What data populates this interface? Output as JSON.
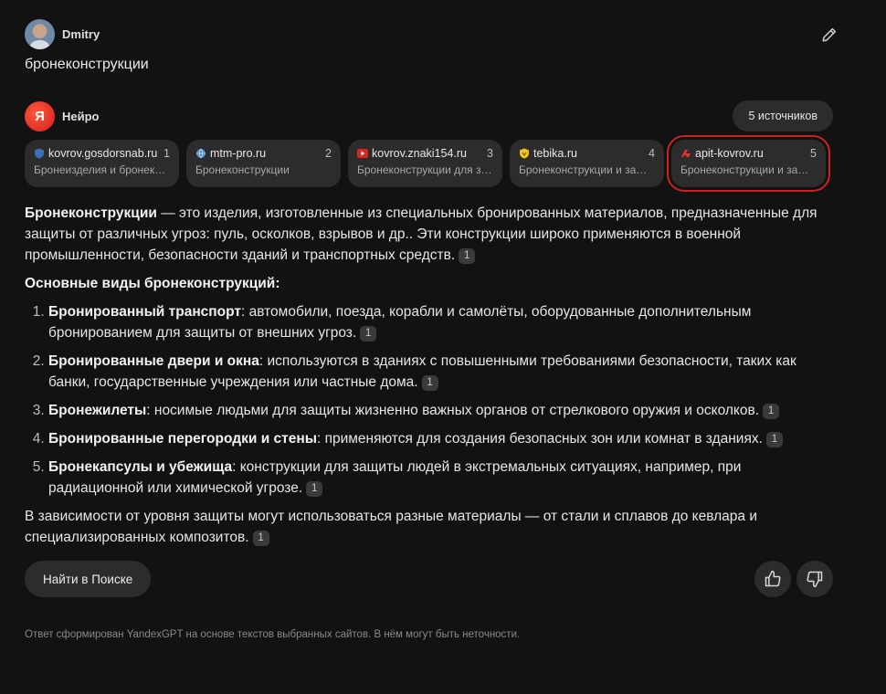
{
  "user": {
    "name": "Dmitry"
  },
  "query": "бронеконструкции",
  "neuro": {
    "logo_text": "Я",
    "name": "Нейро"
  },
  "sources_button": "5 источников",
  "sources": [
    {
      "domain": "kovrov.gosdorsnab.ru",
      "num": "1",
      "desc": "Бронеизделия и бронеконструкции",
      "icon": "shield-blue-icon"
    },
    {
      "domain": "mtm-pro.ru",
      "num": "2",
      "desc": "Бронеконструкции",
      "icon": "globe-icon"
    },
    {
      "domain": "kovrov.znaki154.ru",
      "num": "3",
      "desc": "Бронеконструкции для защиты",
      "icon": "red-play-icon"
    },
    {
      "domain": "tebika.ru",
      "num": "4",
      "desc": "Бронеконструкции и защитные",
      "icon": "yellow-shield-icon"
    },
    {
      "domain": "apit-kovrov.ru",
      "num": "5",
      "desc": "Бронеконструкции и защита",
      "icon": "red-logo-icon"
    }
  ],
  "answer": {
    "intro_bold": "Бронеконструкции",
    "intro_text": " — это изделия, изготовленные из специальных бронированных материалов, предназначенные для защиты от различных угроз: пуль, осколков, взрывов и др.. Эти конструкции широко применяются в военной промышленности, безопасности зданий и транспортных средств.",
    "intro_cite": "1",
    "heading": "Основные виды бронеконструкций:",
    "items": [
      {
        "bold": "Бронированный транспорт",
        "text": ": автомобили, поезда, корабли и самолёты, оборудованные дополнительным бронированием для защиты от внешних угроз.",
        "cite": "1"
      },
      {
        "bold": "Бронированные двери и окна",
        "text": ": используются в зданиях с повышенными требованиями безопасности, таких как банки, государственные учреждения или частные дома.",
        "cite": "1"
      },
      {
        "bold": "Бронежилеты",
        "text": ": носимые людьми для защиты жизненно важных органов от стрелкового оружия и осколков.",
        "cite": "1"
      },
      {
        "bold": "Бронированные перегородки и стены",
        "text": ": применяются для создания безопасных зон или комнат в зданиях.",
        "cite": "1"
      },
      {
        "bold": "Бронекапсулы и убежища",
        "text": ": конструкции для защиты людей в экстремальных ситуациях, например, при радиационной или химической угрозе.",
        "cite": "1"
      }
    ],
    "outro_text": "В зависимости от уровня защиты могут использоваться разные материалы — от стали и сплавов до кевлара и специализированных композитов.",
    "outro_cite": "1"
  },
  "find_button": "Найти в Поиске",
  "disclaimer": "Ответ сформирован YandexGPT на основе текстов выбранных сайтов. В нём могут быть неточности."
}
